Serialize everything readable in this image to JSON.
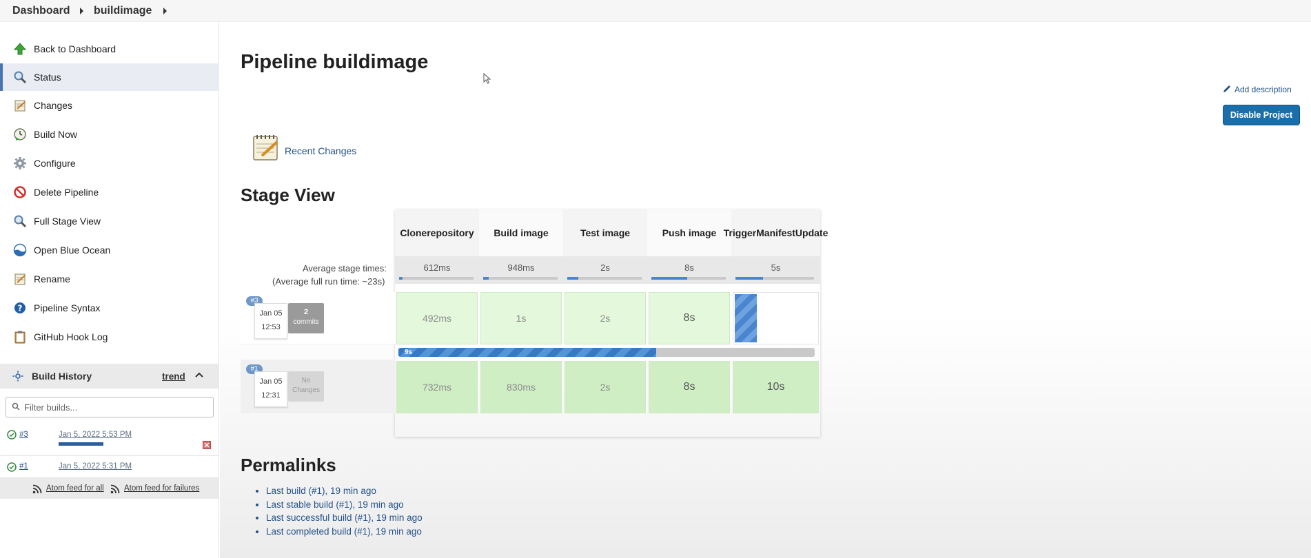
{
  "breadcrumb": {
    "items": [
      "Dashboard",
      "buildimage"
    ]
  },
  "sidebar": {
    "items": [
      {
        "label": "Back to Dashboard",
        "icon": "up-arrow-icon"
      },
      {
        "label": "Status",
        "icon": "magnifier-icon"
      },
      {
        "label": "Changes",
        "icon": "notepad-icon"
      },
      {
        "label": "Build Now",
        "icon": "clock-play-icon"
      },
      {
        "label": "Configure",
        "icon": "gear-icon"
      },
      {
        "label": "Delete Pipeline",
        "icon": "no-entry-icon"
      },
      {
        "label": "Full Stage View",
        "icon": "magnifier-icon"
      },
      {
        "label": "Open Blue Ocean",
        "icon": "blue-ocean-icon"
      },
      {
        "label": "Rename",
        "icon": "notepad-icon"
      },
      {
        "label": "Pipeline Syntax",
        "icon": "help-icon"
      },
      {
        "label": "GitHub Hook Log",
        "icon": "clipboard-icon"
      }
    ],
    "active_index": 1,
    "build_history": {
      "title": "Build History",
      "trend_label": "trend",
      "filter_placeholder": "Filter builds...",
      "builds": [
        {
          "number": "#3",
          "date": "Jan 5, 2022 5:53 PM",
          "in_progress": true
        },
        {
          "number": "#1",
          "date": "Jan 5, 2022 5:31 PM",
          "in_progress": false
        }
      ],
      "feed_all": "Atom feed for all",
      "feed_failures": "Atom feed for failures"
    }
  },
  "main": {
    "title": "Pipeline buildimage",
    "add_description": "Add description",
    "disable_button": "Disable Project",
    "recent_changes": "Recent Changes",
    "stage_view_title": "Stage View",
    "avg_stage_label": "Average stage times:",
    "avg_full_label": "(Average full run time: ~23s)",
    "stages": [
      {
        "name_line1": "Clone",
        "name_line2": "repository",
        "avg": "612ms",
        "avg_fill": 0.05
      },
      {
        "name_line1": "Build image",
        "name_line2": "",
        "avg": "948ms",
        "avg_fill": 0.07
      },
      {
        "name_line1": "Test image",
        "name_line2": "",
        "avg": "2s",
        "avg_fill": 0.15
      },
      {
        "name_line1": "Push image",
        "name_line2": "",
        "avg": "8s",
        "avg_fill": 0.48
      },
      {
        "name_line1": "Trigger",
        "name_line2": "ManifestUpdate",
        "avg": "5s",
        "avg_fill": 0.35
      }
    ],
    "runs": [
      {
        "badge": "#3",
        "date": "Jan 05",
        "time": "12:53",
        "changes_line1": "2",
        "changes_line2": "commits",
        "cells": [
          "492ms",
          "1s",
          "2s",
          "8s",
          ""
        ]
      },
      {
        "badge": "#1",
        "date": "Jan 05",
        "time": "12:31",
        "changes_line1": "No",
        "changes_line2": "Changes",
        "cells": [
          "732ms",
          "830ms",
          "2s",
          "8s",
          "10s"
        ]
      }
    ],
    "progress": {
      "label": "9s",
      "fraction": 0.62
    },
    "permalinks_title": "Permalinks",
    "permalinks": [
      "Last build (#1), 19 min ago",
      "Last stable build (#1), 19 min ago",
      "Last successful build (#1), 19 min ago",
      "Last completed build (#1), 19 min ago"
    ]
  },
  "colors": {
    "accent": "#1a6fab",
    "link": "#24528b",
    "success_cell": "#e4f8dc",
    "progress": "#4a86cf"
  }
}
